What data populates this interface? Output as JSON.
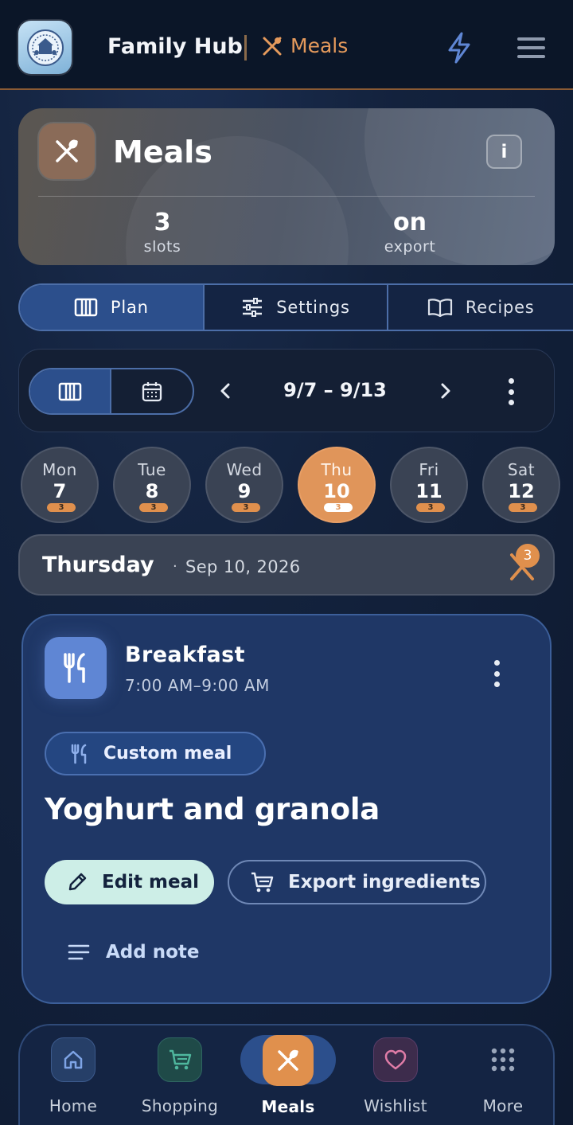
{
  "header": {
    "app_title": "Family Hub",
    "section": "Meals"
  },
  "hero": {
    "title": "Meals",
    "info_label": "i",
    "stats": [
      {
        "value": "3",
        "label": "slots"
      },
      {
        "value": "on",
        "label": "export"
      }
    ]
  },
  "tabs": [
    {
      "label": "Plan",
      "icon": "columns-icon",
      "active": true
    },
    {
      "label": "Settings",
      "icon": "sliders-icon",
      "active": false
    },
    {
      "label": "Recipes",
      "icon": "book-icon",
      "active": false
    }
  ],
  "week": {
    "range": "9/7 – 9/13"
  },
  "days": [
    {
      "name": "Mon",
      "date": "7",
      "count": "3"
    },
    {
      "name": "Tue",
      "date": "8",
      "count": "3"
    },
    {
      "name": "Wed",
      "date": "9",
      "count": "3"
    },
    {
      "name": "Thu",
      "date": "10",
      "count": "3",
      "selected": true
    },
    {
      "name": "Fri",
      "date": "11",
      "count": "3"
    },
    {
      "name": "Sat",
      "date": "12",
      "count": "3"
    }
  ],
  "selected_day": {
    "day_name": "Thursday",
    "separator": "·",
    "date": "Sep 10, 2026",
    "meal_count": "3"
  },
  "meal": {
    "title": "Breakfast",
    "time": "7:00 AM–9:00 AM",
    "type_label": "Custom meal",
    "name": "Yoghurt and granola",
    "edit_label": "Edit meal",
    "export_label": "Export ingredients",
    "note_label": "Add note"
  },
  "bottom_nav": [
    {
      "label": "Home",
      "icon": "home-icon"
    },
    {
      "label": "Shopping",
      "icon": "cart-icon"
    },
    {
      "label": "Meals",
      "icon": "utensils-icon",
      "active": true
    },
    {
      "label": "Wishlist",
      "icon": "heart-icon"
    },
    {
      "label": "More",
      "icon": "grid-icon"
    }
  ],
  "colors": {
    "accent": "#e0904d",
    "primary": "#2c4f8c",
    "background": "#13223d"
  }
}
